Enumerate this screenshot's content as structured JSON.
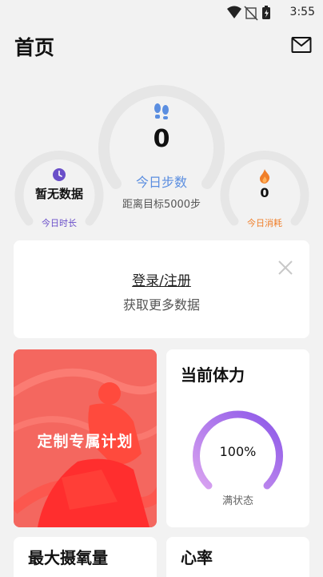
{
  "status_bar": {
    "time": "3:55"
  },
  "header": {
    "title": "首页"
  },
  "steps": {
    "value": "0",
    "label": "今日步数",
    "goal_text": "距离目标5000步"
  },
  "duration": {
    "value_text": "暂无数据",
    "label": "今日时长"
  },
  "calories": {
    "value": "0",
    "label": "今日消耗"
  },
  "login_card": {
    "link": "登录/注册",
    "subtitle": "获取更多数据"
  },
  "plan_card": {
    "label": "定制专属计划"
  },
  "energy_card": {
    "title": "当前体力",
    "value": "100%",
    "status": "满状态",
    "level": 1.0
  },
  "vo2_card": {
    "title": "最大摄氧量"
  },
  "heart_card": {
    "title": "心率"
  },
  "colors": {
    "steps_accent": "#5b8ee0",
    "duration_accent": "#6a4fc9",
    "calories_accent": "#f07f2a",
    "energy_gradient_start": "#8b56e8",
    "energy_gradient_end": "#d9a3f0",
    "plan_card_bg": "#f4675f"
  },
  "icons": {
    "mail": "mail-icon",
    "steps": "footprints-icon",
    "duration": "clock-icon",
    "calories": "flame-icon",
    "close": "close-icon"
  }
}
